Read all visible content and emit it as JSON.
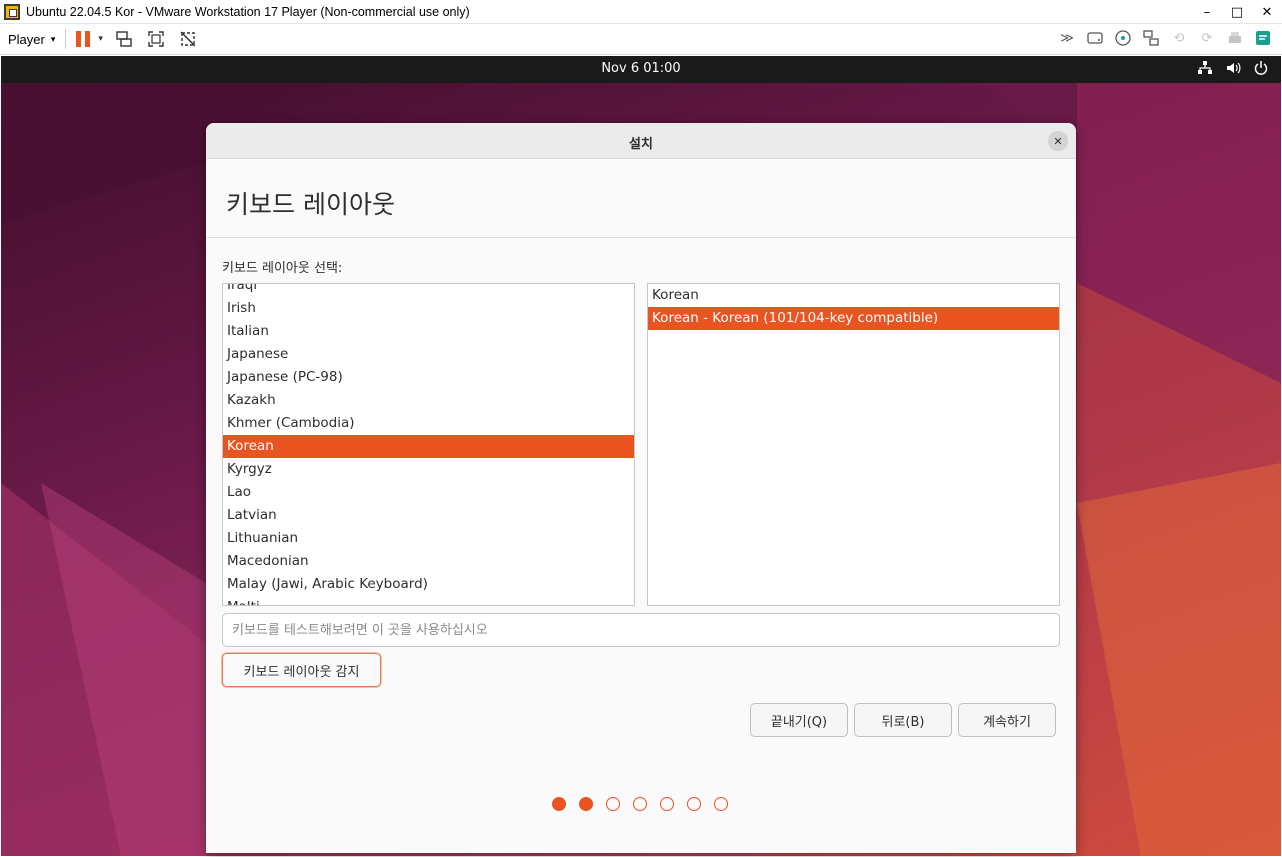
{
  "window": {
    "title": "Ubuntu 22.04.5 Kor - VMware Workstation 17 Player (Non-commercial use only)",
    "controls": {
      "minimize": "–",
      "maximize": "□",
      "close": "✕"
    }
  },
  "toolbar": {
    "player_label": "Player",
    "caret": "▾",
    "right_more": "≫"
  },
  "ubuntu_topbar": {
    "clock": "Nov 6  01:00",
    "icons": [
      "network-icon",
      "volume-icon",
      "power-icon"
    ]
  },
  "dialog": {
    "title": "설치",
    "close": "✕",
    "heading": "키보드 레이아웃",
    "select_label": "키보드 레이아웃 선택:",
    "layouts": [
      {
        "label": "Iraqi",
        "selected": false
      },
      {
        "label": "Irish",
        "selected": false
      },
      {
        "label": "Italian",
        "selected": false
      },
      {
        "label": "Japanese",
        "selected": false
      },
      {
        "label": "Japanese (PC-98)",
        "selected": false
      },
      {
        "label": "Kazakh",
        "selected": false
      },
      {
        "label": "Khmer (Cambodia)",
        "selected": false
      },
      {
        "label": "Korean",
        "selected": true
      },
      {
        "label": "Kyrgyz",
        "selected": false
      },
      {
        "label": "Lao",
        "selected": false
      },
      {
        "label": "Latvian",
        "selected": false
      },
      {
        "label": "Lithuanian",
        "selected": false
      },
      {
        "label": "Macedonian",
        "selected": false
      },
      {
        "label": "Malay (Jawi, Arabic Keyboard)",
        "selected": false
      },
      {
        "label": "Malti",
        "selected": false
      }
    ],
    "variants": [
      {
        "label": "Korean",
        "selected": false
      },
      {
        "label": "Korean - Korean (101/104-key compatible)",
        "selected": true
      }
    ],
    "test_placeholder": "키보드를 테스트해보려면 이 곳을 사용하십시오",
    "detect_button": "키보드 레이아웃 감지",
    "quit_button": "끝내기(Q)",
    "back_button": "뒤로(B)",
    "continue_button": "계속하기",
    "progress": {
      "total_steps": 7,
      "completed_steps": 2
    }
  },
  "colors": {
    "accent": "#e95420",
    "topbar": "#1a1a1a",
    "dialog_bg": "#fafafa"
  }
}
